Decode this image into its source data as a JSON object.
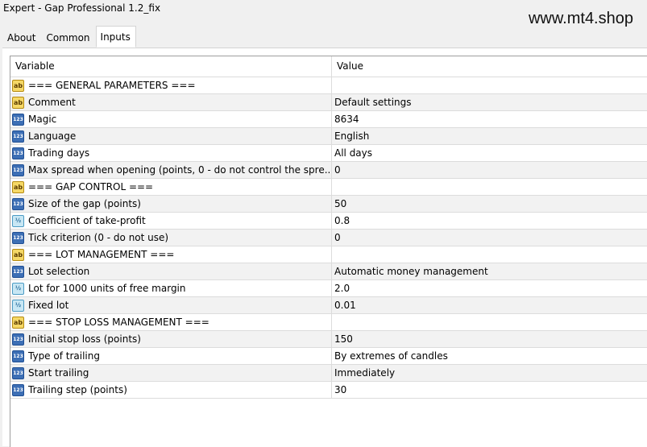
{
  "window": {
    "title": "Expert - Gap Professional 1.2_fix",
    "watermark": "www.mt4.shop"
  },
  "tabs": [
    {
      "label": "About",
      "active": false
    },
    {
      "label": "Common",
      "active": false
    },
    {
      "label": "Inputs",
      "active": true
    }
  ],
  "table": {
    "headers": {
      "variable": "Variable",
      "value": "Value"
    },
    "rows": [
      {
        "icon": "string-icon",
        "icon_text": "ab",
        "variable": "=== GENERAL PARAMETERS ===",
        "value": ""
      },
      {
        "icon": "string-icon",
        "icon_text": "ab",
        "variable": "Comment",
        "value": "Default settings"
      },
      {
        "icon": "integer-icon",
        "icon_text": "123",
        "variable": "Magic",
        "value": "8634"
      },
      {
        "icon": "integer-icon",
        "icon_text": "123",
        "variable": "Language",
        "value": "English"
      },
      {
        "icon": "integer-icon",
        "icon_text": "123",
        "variable": "Trading days",
        "value": "All days"
      },
      {
        "icon": "integer-icon",
        "icon_text": "123",
        "variable": "Max spread when opening (points, 0 - do not control the spre...",
        "value": "0"
      },
      {
        "icon": "string-icon",
        "icon_text": "ab",
        "variable": "=== GAP CONTROL ===",
        "value": ""
      },
      {
        "icon": "integer-icon",
        "icon_text": "123",
        "variable": "Size of the gap (points)",
        "value": "50"
      },
      {
        "icon": "double-icon",
        "icon_text": "½",
        "variable": "Coefficient of take-profit",
        "value": "0.8"
      },
      {
        "icon": "integer-icon",
        "icon_text": "123",
        "variable": "Tick criterion (0 - do not use)",
        "value": "0"
      },
      {
        "icon": "string-icon",
        "icon_text": "ab",
        "variable": "=== LOT MANAGEMENT ===",
        "value": ""
      },
      {
        "icon": "integer-icon",
        "icon_text": "123",
        "variable": "Lot selection",
        "value": "Automatic money management"
      },
      {
        "icon": "double-icon",
        "icon_text": "½",
        "variable": "Lot for 1000 units of free margin",
        "value": "2.0"
      },
      {
        "icon": "double-icon",
        "icon_text": "½",
        "variable": "Fixed lot",
        "value": "0.01"
      },
      {
        "icon": "string-icon",
        "icon_text": "ab",
        "variable": "=== STOP LOSS MANAGEMENT ===",
        "value": ""
      },
      {
        "icon": "integer-icon",
        "icon_text": "123",
        "variable": "Initial stop loss (points)",
        "value": "150"
      },
      {
        "icon": "integer-icon",
        "icon_text": "123",
        "variable": "Type of trailing",
        "value": "By extremes of candles"
      },
      {
        "icon": "integer-icon",
        "icon_text": "123",
        "variable": "Start trailing",
        "value": "Immediately"
      },
      {
        "icon": "integer-icon",
        "icon_text": "123",
        "variable": "Trailing step (points)",
        "value": "30"
      }
    ]
  }
}
